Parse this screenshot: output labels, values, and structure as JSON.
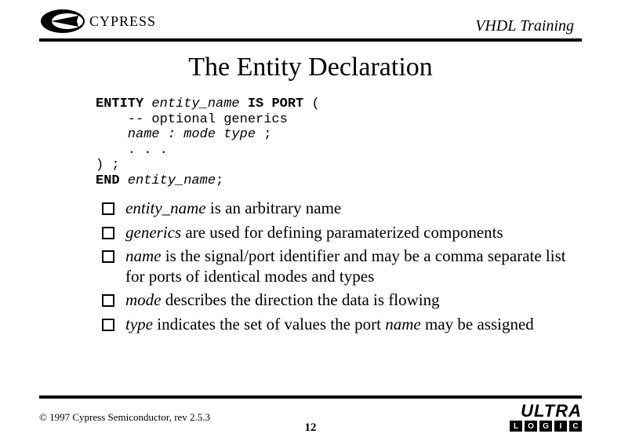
{
  "header": {
    "logo_text": "CYPRESS",
    "title": "VHDL Training"
  },
  "slide": {
    "title": "The Entity Declaration"
  },
  "code": {
    "l1a": "ENTITY",
    "l1b": " entity_name",
    "l1c": " IS PORT",
    "l1d": " (",
    "l2": "    -- optional generics",
    "l3": "    name : mode type",
    "l3b": " ;",
    "l4": "    . . .",
    "l5": ") ;",
    "l6a": "END",
    "l6b": " entity_name",
    "l6c": ";"
  },
  "bullets": [
    {
      "term": "entity_name",
      "rest": " is an arbitrary name"
    },
    {
      "term": "generics",
      "rest": " are used for defining paramaterized components"
    },
    {
      "term": "name",
      "rest": " is the signal/port identifier and may be a comma separate list for ports of identical modes and types"
    },
    {
      "term": "mode",
      "rest": " describes the direction the data is flowing"
    },
    {
      "term": "type",
      "rest_a": " indicates the set of values the port ",
      "term2": "name",
      "rest_b": " may be assigned"
    }
  ],
  "footer": {
    "copyright": "© 1997 Cypress Semiconductor, rev 2.5.3",
    "page": "12",
    "ultra": "ULTRA",
    "boxes": [
      "L",
      "O",
      "G",
      "I",
      "C"
    ]
  }
}
